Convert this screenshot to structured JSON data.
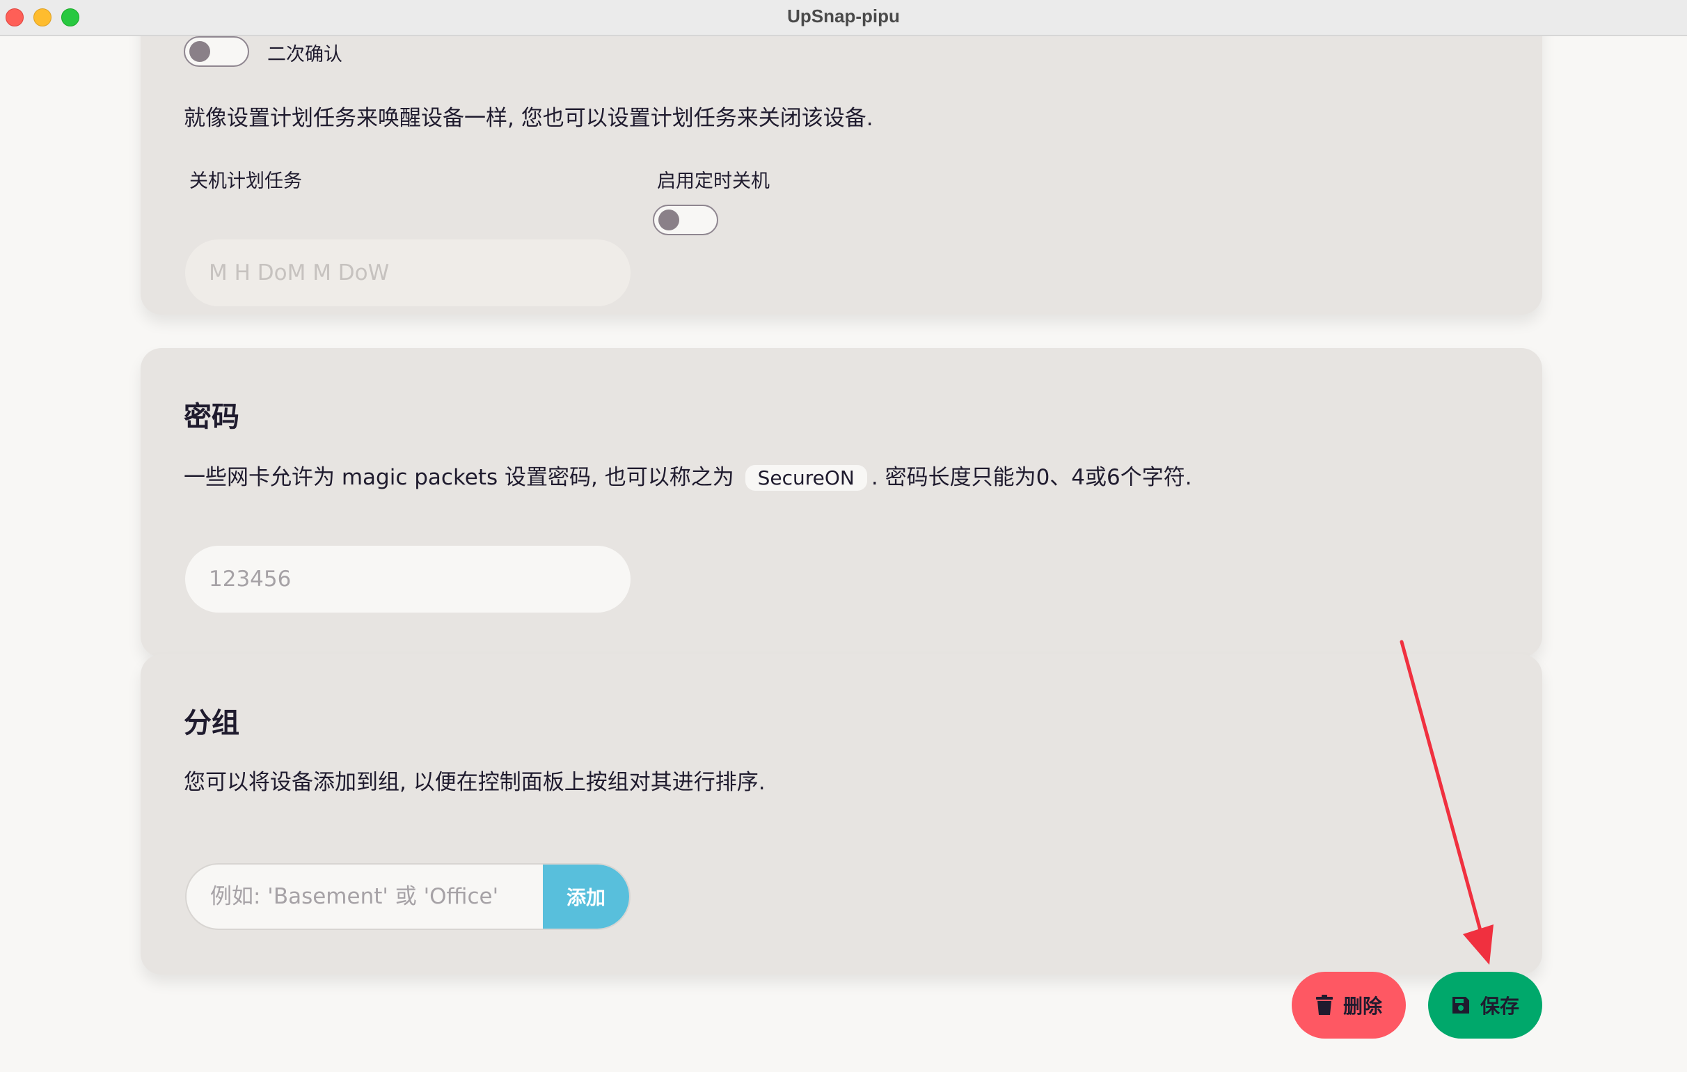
{
  "window": {
    "title": "UpSnap-pipu"
  },
  "shutdown_section": {
    "confirm_toggle_label": "二次确认",
    "description": "就像设置计划任务来唤醒设备一样, 您也可以设置计划任务来关闭该设备.",
    "cron_label": "关机计划任务",
    "cron_placeholder": "M H DoM M DoW",
    "cron_value": "",
    "enable_label": "启用定时关机"
  },
  "password_section": {
    "title": "密码",
    "description_before": "一些网卡允许为 magic packets 设置密码, 也可以称之为",
    "code": "SecureON",
    "description_after": ". 密码长度只能为0、4或6个字符.",
    "placeholder": "123456",
    "value": ""
  },
  "group_section": {
    "title": "分组",
    "description": "您可以将设备添加到组, 以便在控制面板上按组对其进行排序.",
    "placeholder": "例如: 'Basement' 或 'Office'",
    "value": "",
    "add_label": "添加"
  },
  "actions": {
    "delete_label": "删除",
    "save_label": "保存"
  },
  "colors": {
    "delete": "#fe5863",
    "save": "#00a86b",
    "add": "#58bfdc",
    "annotation_arrow": "#f0303f"
  },
  "icons": {
    "delete": "trash-icon",
    "save": "floppy-disk-icon"
  }
}
